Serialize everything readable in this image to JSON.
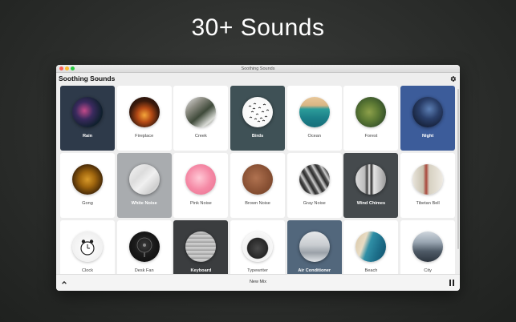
{
  "promo": {
    "headline": "30+ Sounds"
  },
  "window": {
    "title": "Soothing Sounds"
  },
  "app": {
    "title": "Soothing Sounds",
    "settings_icon": "gear-icon"
  },
  "footer": {
    "new_mix_label": "New Mix",
    "collapse_icon": "chevron-up-icon",
    "pause_icon": "pause-icon"
  },
  "sounds": [
    {
      "label": "Rain",
      "active": true,
      "tile_color": "#2e3a4a",
      "art": "rain"
    },
    {
      "label": "Fireplace",
      "active": false,
      "tile_color": "#ffffff",
      "art": "fireplace"
    },
    {
      "label": "Creek",
      "active": false,
      "tile_color": "#ffffff",
      "art": "creek"
    },
    {
      "label": "Birds",
      "active": true,
      "tile_color": "#3f5156",
      "art": "birds"
    },
    {
      "label": "Ocean",
      "active": false,
      "tile_color": "#ffffff",
      "art": "ocean"
    },
    {
      "label": "Forest",
      "active": false,
      "tile_color": "#ffffff",
      "art": "forest"
    },
    {
      "label": "Night",
      "active": true,
      "tile_color": "#3c5c9a",
      "art": "night"
    },
    {
      "label": "Gong",
      "active": false,
      "tile_color": "#ffffff",
      "art": "gong"
    },
    {
      "label": "White Noise",
      "active": true,
      "tile_color": "#a9acaf",
      "art": "white-noise"
    },
    {
      "label": "Pink Noise",
      "active": false,
      "tile_color": "#ffffff",
      "art": "pink-noise"
    },
    {
      "label": "Brown Noise",
      "active": false,
      "tile_color": "#ffffff",
      "art": "brown-noise"
    },
    {
      "label": "Gray Noise",
      "active": false,
      "tile_color": "#ffffff",
      "art": "gray-noise"
    },
    {
      "label": "Wind Chimes",
      "active": true,
      "tile_color": "#454a4d",
      "art": "wind-chimes"
    },
    {
      "label": "Tibetan Bell",
      "active": false,
      "tile_color": "#ffffff",
      "art": "tibetan-bell"
    },
    {
      "label": "Clock",
      "active": false,
      "tile_color": "#ffffff",
      "art": "clock"
    },
    {
      "label": "Desk Fan",
      "active": false,
      "tile_color": "#ffffff",
      "art": "desk-fan"
    },
    {
      "label": "Keyboard",
      "active": true,
      "tile_color": "#3b3d3f",
      "art": "keyboard"
    },
    {
      "label": "Typewriter",
      "active": false,
      "tile_color": "#ffffff",
      "art": "typewriter"
    },
    {
      "label": "Air Conditioner",
      "active": true,
      "tile_color": "#52677c",
      "art": "air-conditioner"
    },
    {
      "label": "Beach",
      "active": false,
      "tile_color": "#ffffff",
      "art": "beach"
    },
    {
      "label": "City",
      "active": false,
      "tile_color": "#ffffff",
      "art": "city"
    }
  ]
}
